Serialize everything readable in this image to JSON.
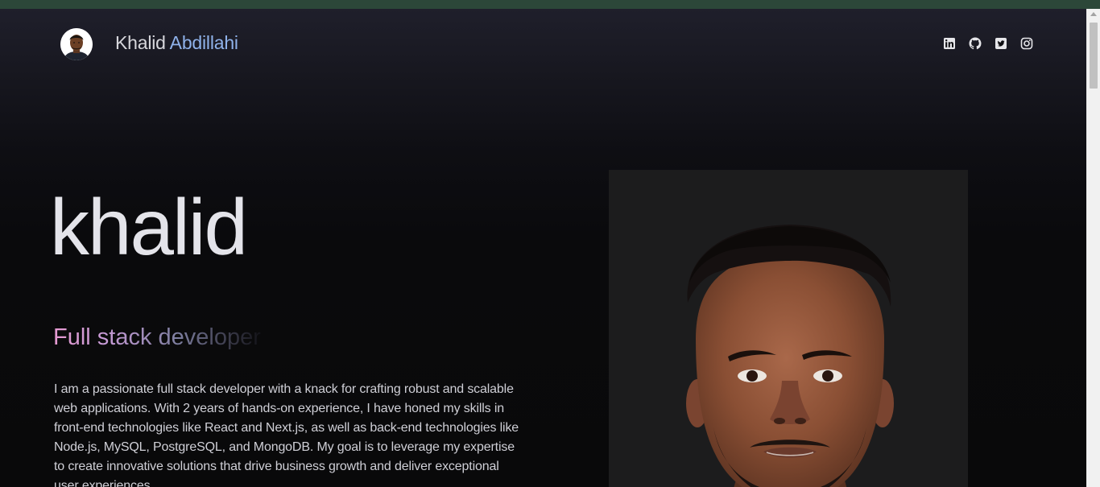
{
  "header": {
    "first_name": "Khalid",
    "last_name": "Abdillahi",
    "social_icons": [
      "linkedin-icon",
      "github-icon",
      "twitter-icon",
      "instagram-icon"
    ]
  },
  "hero": {
    "name": "khalid",
    "role": "Full stack developer",
    "bio": "I am a passionate full stack developer with a knack for crafting robust and scalable web applications. With 2 years of hands-on experience, I have honed my skills in front-end technologies like React and Next.js, as well as back-end technologies like Node.js, MySQL, PostgreSQL, and MongoDB. My goal is to leverage my expertise to create innovative solutions that drive business growth and deliver exceptional user experiences."
  },
  "colors": {
    "browser_strip": "#2c4739",
    "accent_last_name": "#8fb2ea",
    "role_gradient_start": "#e69ad1",
    "card_background": "#1c1c1d"
  }
}
